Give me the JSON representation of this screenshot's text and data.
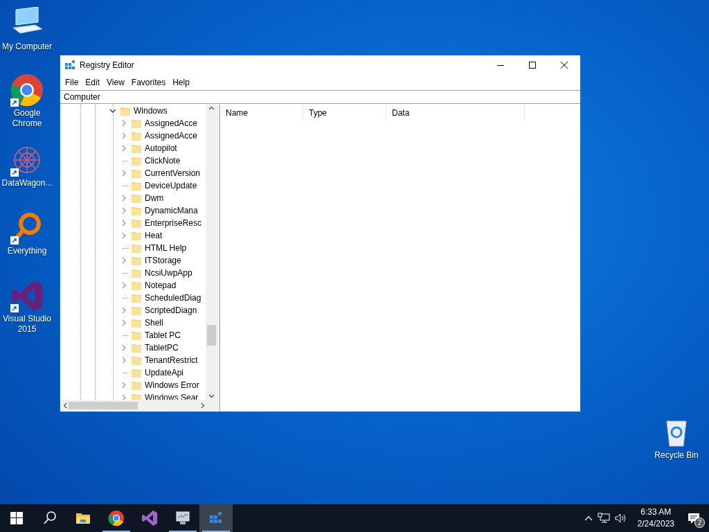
{
  "desktop_icons": [
    {
      "label": "My Computer",
      "kind": "computer",
      "shortcut": false
    },
    {
      "label": "Google Chrome",
      "kind": "chrome",
      "shortcut": true
    },
    {
      "label": "DataWagon...",
      "kind": "datawagon",
      "shortcut": true
    },
    {
      "label": "Everything",
      "kind": "everything",
      "shortcut": true
    },
    {
      "label": "Visual Studio 2015",
      "kind": "vs",
      "shortcut": true
    },
    {
      "label": "Recycle Bin",
      "kind": "recycle",
      "shortcut": false
    }
  ],
  "window": {
    "title": "Registry Editor",
    "menu": [
      "File",
      "Edit",
      "View",
      "Favorites",
      "Help"
    ],
    "address": "Computer",
    "tree": {
      "label": "Windows",
      "expanded": true,
      "children": [
        {
          "label": "AssignedAcce",
          "expandable": true
        },
        {
          "label": "AssignedAcce",
          "expandable": true
        },
        {
          "label": "Autopilot",
          "expandable": true
        },
        {
          "label": "ClickNote",
          "expandable": false
        },
        {
          "label": "CurrentVersion",
          "expandable": true
        },
        {
          "label": "DeviceUpdate",
          "expandable": false
        },
        {
          "label": "Dwm",
          "expandable": true
        },
        {
          "label": "DynamicMana",
          "expandable": true
        },
        {
          "label": "EnterpriseResc",
          "expandable": true
        },
        {
          "label": "Heat",
          "expandable": true
        },
        {
          "label": "HTML Help",
          "expandable": false
        },
        {
          "label": "ITStorage",
          "expandable": true
        },
        {
          "label": "NcsiUwpApp",
          "expandable": false
        },
        {
          "label": "Notepad",
          "expandable": true
        },
        {
          "label": "ScheduledDiag",
          "expandable": false
        },
        {
          "label": "ScriptedDiagn",
          "expandable": true
        },
        {
          "label": "Shell",
          "expandable": true
        },
        {
          "label": "Tablet PC",
          "expandable": false
        },
        {
          "label": "TabletPC",
          "expandable": true
        },
        {
          "label": "TenantRestrict",
          "expandable": true
        },
        {
          "label": "UpdateApi",
          "expandable": false
        },
        {
          "label": "Windows Error",
          "expandable": true
        },
        {
          "label": "Windows Sear",
          "expandable": true
        }
      ]
    },
    "columns": [
      "Name",
      "Type",
      "Data"
    ]
  },
  "taskbar": {
    "items": [
      {
        "kind": "start",
        "running": false,
        "selected": false
      },
      {
        "kind": "search",
        "running": false,
        "selected": false
      },
      {
        "kind": "explorer",
        "running": false,
        "selected": false
      },
      {
        "kind": "chrome",
        "running": true,
        "selected": false
      },
      {
        "kind": "vs",
        "running": false,
        "selected": false
      },
      {
        "kind": "monitor",
        "running": true,
        "selected": false
      },
      {
        "kind": "regedit",
        "running": true,
        "selected": true
      }
    ],
    "time": "6:33 AM",
    "date": "2/24/2023",
    "notifications": "2"
  }
}
